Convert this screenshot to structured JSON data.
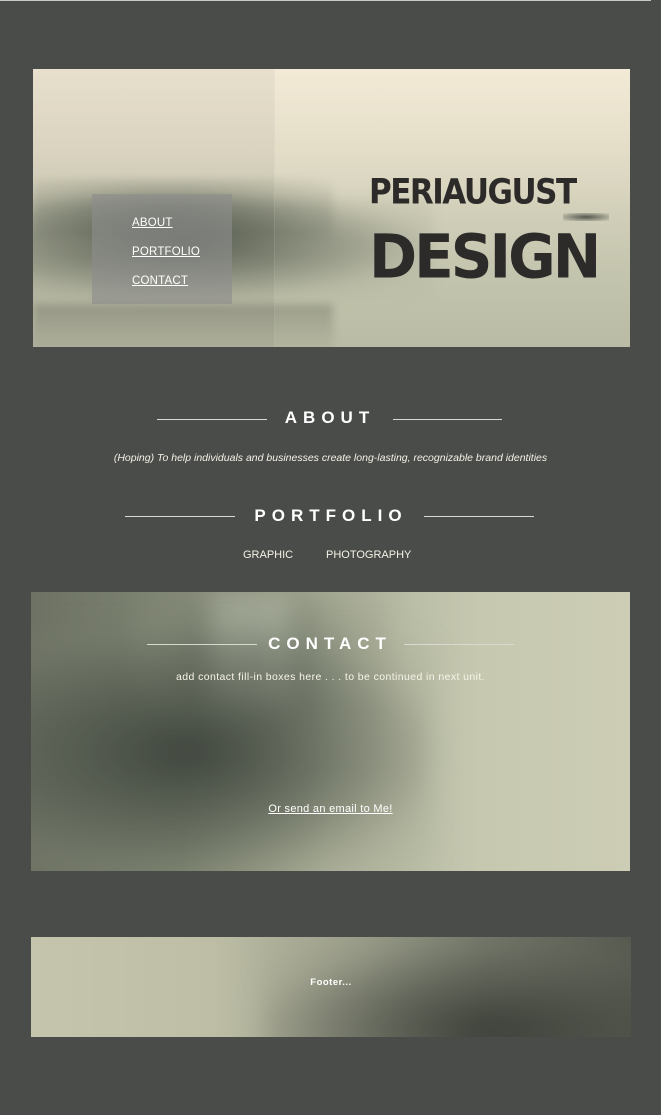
{
  "header": {
    "brand_line1": "PERIAUGUST",
    "brand_line2": "DESIGN",
    "nav": [
      {
        "label": "ABOUT"
      },
      {
        "label": "PORTFOLIO"
      },
      {
        "label": "CONTACT"
      }
    ]
  },
  "about": {
    "title": "ABOUT",
    "text": "(Hoping) To help individuals and businesses create long-lasting, recognizable brand identities"
  },
  "portfolio": {
    "title": "PORTFOLIO",
    "links": [
      {
        "label": "GRAPHIC"
      },
      {
        "label": "PHOTOGRAPHY"
      }
    ]
  },
  "contact": {
    "title": "CONTACT",
    "subtitle": "add contact fill-in boxes here . . . to be continued in next unit.",
    "email_link": "Or send an email to Me!"
  },
  "footer": {
    "text": "Footer..."
  },
  "colors": {
    "page_background": "#4a4c49",
    "brand_text": "#2d2a2a",
    "nav_box": "#8c8c8c",
    "heading_text": "#ffffff"
  }
}
